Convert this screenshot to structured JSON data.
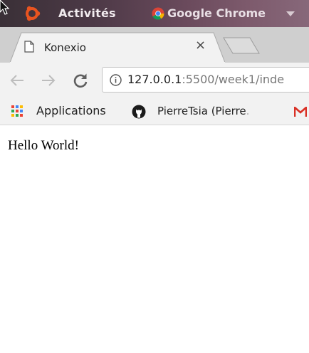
{
  "topbar": {
    "activities_label": "Activités",
    "app_menu_label": "Google Chrome",
    "app_menu_arrow": "▾"
  },
  "tab": {
    "title": "Konexio",
    "close_glyph": "×",
    "favicon": "page-icon"
  },
  "toolbar": {
    "url_host": "127.0.0.1",
    "url_path": ":5500/week1/inde",
    "info_glyph": "i"
  },
  "bookmarks": {
    "apps_label": "Applications",
    "github_label": "PierreTsia (Pierre",
    "github_label_fade": "."
  },
  "page": {
    "text": "Hello World!"
  },
  "colors": {
    "topbar": "#4c3946",
    "ubuntu_orange": "#e95420",
    "gmail_red": "#d93025"
  }
}
